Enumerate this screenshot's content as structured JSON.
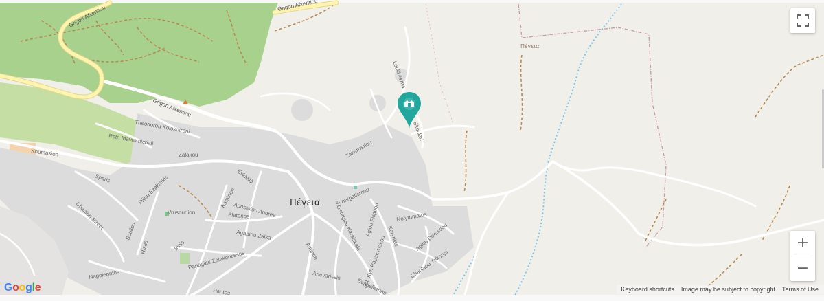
{
  "map": {
    "town_name": "Πέγεια",
    "area_name": "Πέγεια",
    "roads": {
      "grigori_top": "Grigori Afxentiou",
      "grigori_top2": "Grigori Afxentiou",
      "grigori_mid": "Grigori Afxentiou"
    },
    "streets": {
      "loukiakrita": "Louki Akrita",
      "theodorou": "Theodorou Kolokotroni",
      "mavromichali": "Petr. Mavromichali",
      "koumasion": "Koumasion",
      "zalakou": "Zalakou",
      "sparis": "Sparis",
      "chanion": "Chanion Street",
      "filiou": "Filiou Ezakreias",
      "vrusoudion": "Vrusoudion",
      "souliou": "Souliou",
      "rizas": "Rizas",
      "irinis": "Irinis",
      "napoleontos": "Napoleontos",
      "panagias": "Panagias Zalakontissas",
      "agapiou": "Agapiou Zalka",
      "platonos": "Platonos",
      "apostolou": "Apostolou Andrea",
      "kaminon": "Kaminon",
      "evklidi": "Evkleidi",
      "athinon": "Athinon",
      "zaxarou": "Zaxaroeriou",
      "synergatismou": "Synergatismou",
      "georgiou": "Georgiou Karaiskaki",
      "agiou_filippou": "Agiou Filippou",
      "kerinias": "Kerynias",
      "nolymmatos": "Nolymmatos",
      "agiou_dometiou": "Agiou Dometiou",
      "charilaou": "Charilaou Trikoupi",
      "sotkyr": "Sot. Kyr. Papakyriakou",
      "arievarissis": "Arievarissis",
      "evagelistrias": "Evagelistrias",
      "skoulari": "Skoulari",
      "mantos": "Pantos"
    }
  },
  "controls": {
    "zoom_in": "+",
    "zoom_out": "−"
  },
  "attribution": {
    "keyboard_shortcuts": "Keyboard shortcuts",
    "image_subject": "Image may be subject to copyright",
    "terms": "Terms of Use"
  },
  "logo": {
    "letters": [
      "G",
      "o",
      "o",
      "g",
      "l",
      "e"
    ],
    "colors": [
      "#4285f4",
      "#ea4335",
      "#fbbc05",
      "#4285f4",
      "#34a853",
      "#ea4335"
    ]
  },
  "colors": {
    "land": "#f1efe9",
    "forest": "#a8d18d",
    "urban": "#dddcdc",
    "road": "#ffffff",
    "highway": "#fdf4b0",
    "marker": "#21a79c",
    "trail": "#b78a55",
    "water_path": "#7fc4e6"
  },
  "icons": {
    "marker": "location-marker-icon",
    "fullscreen": "fullscreen-icon"
  }
}
